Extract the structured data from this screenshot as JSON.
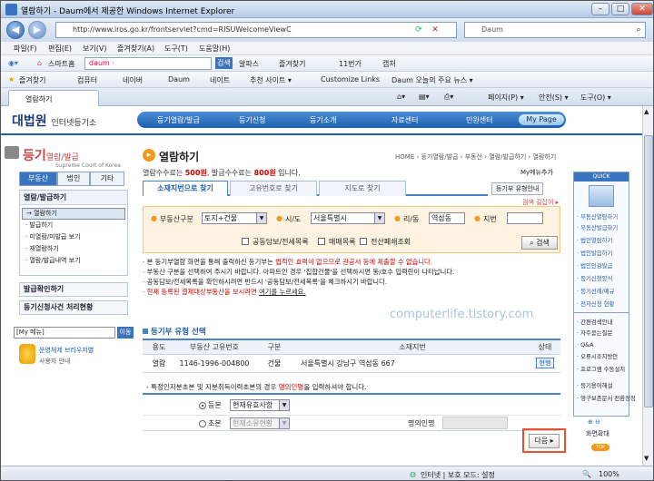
{
  "window": {
    "title": "열람하기 - Daum에서 제공한 Windows Internet Explorer",
    "address": "http://www.iros.go.kr/frontservlet?cmd=RISUWelcomeViewC",
    "search_placeholder": "Daum"
  },
  "menubar": [
    "파일(F)",
    "편집(E)",
    "보기(V)",
    "즐겨찾기(A)",
    "도구(T)",
    "도움말(H)"
  ],
  "toolbar1": {
    "smart_home": "스마트홈",
    "daum_search": "daum ·",
    "search_btn": "검색",
    "items": [
      "알파스",
      "즐겨찾기",
      "11번가",
      "캡처"
    ]
  },
  "toolbar2": {
    "favorites": "즐겨찾기",
    "items": [
      "컴퓨터",
      "네이버",
      "Daum",
      "네이트",
      "추천 사이트 ▾",
      "Customize Links",
      "Daum 오늘의 주요 뉴스 ▾"
    ]
  },
  "tabrow": {
    "tab_label": "열람하기",
    "right_items": [
      "페이지(P) ▾",
      "안전(S) ▾",
      "도구(O) ▾"
    ]
  },
  "site": {
    "logo_main": "대법원",
    "logo_sub": "인터넷등기소",
    "topnav": [
      "등기열람/발급",
      "등기신청",
      "등기소개",
      "자료센터",
      "민원센터"
    ],
    "mypage": "My Page",
    "left": {
      "title_main": "등기",
      "title_sub": "열람/발급",
      "subtitle": "Supreme Court of Korea",
      "tabs": [
        "부동산",
        "법인",
        "기타"
      ],
      "menu_header": "열람/발급하기",
      "menu_items": [
        "→ 열람하기",
        "· 발급하기",
        "· 미열람/미발급 보기",
        "· 재열람하기",
        "· 열람/발급내역 보기"
      ],
      "link1": "발급확인하기",
      "link2": "등기신청사건 처리현황",
      "mymenu_label": "[My 메뉴]",
      "mymenu_btn": "이동",
      "support_title": "운영체제 브라우저별",
      "support_sub": "사용자 안내"
    },
    "main": {
      "page_title": "열람하기",
      "breadcrumb": "HOME › 등기열람/발급 › 부동산 › 열람/발급하기 › 열람하기",
      "my_menu_add": "My메뉴추가",
      "guide": "등기부 유형안내",
      "fee_prefix": "열람수수료는 ",
      "fee1": "500원",
      "fee_mid": ", 발급수수료는 ",
      "fee2": "800원",
      "fee_suffix": " 입니다.",
      "subtabs": [
        "소재지번으로 찾기",
        "고유번호로 찾기",
        "지도로 찾기"
      ],
      "search_help": "검색 길잡이 ▸",
      "form": {
        "realty_type_label": "부동산구분",
        "realty_type_value": "토지+건물",
        "sido_label": "시/도",
        "sido_value": "서울특별시",
        "ridong_label": "리/동",
        "ridong_value": "역삼동",
        "jibun_label": "지번",
        "jibun_value": "",
        "chk1": "공동담보/전세목록",
        "chk2": "매매목록",
        "chk3": "전산폐쇄조회",
        "search_btn": "검색"
      },
      "notes": [
        {
          "text1": "본 등기부열람 화면을 통해 출력하신 등기부는 ",
          "red": "법적인 효력이 없으므로 관공서 등에 제출할 수 없습니다.",
          "text2": ""
        },
        {
          "text1": "부동산 구분을 선택하여 주시기 바랍니다. 아파트인 경우 '집합건물'을 선택하시면 동/호수 입력란이 나타납니다.",
          "red": "",
          "text2": ""
        },
        {
          "text1": "공동담보/전세목록을 확인하시려면 반드시 '공동담보/전세목록'을 체크하시기 바랍니다.",
          "red": "",
          "text2": ""
        },
        {
          "text1": "",
          "red": "현재 등록된 결제대상부동산을 보시려면 ",
          "text2": "여기를 누르세요."
        }
      ],
      "watermark": "computerlife.tistory.com",
      "section_title": "등기부 유형 선택",
      "table": {
        "headers": [
          "용도",
          "부동산 고유번호",
          "구분",
          "소재지번",
          "상태"
        ],
        "rows": [
          [
            "열람",
            "1146-1996-004800",
            "건물",
            "서울특별시 강남구 역삼동 667",
            "현행"
          ]
        ]
      },
      "owner_note_pre": "- 특정인지분초본 및 지분취득이력초본의 경우 ",
      "owner_note_red": "명의인명",
      "owner_note_post": "을 입력하셔야 합니다.",
      "owner": {
        "opt1": "등본",
        "opt1_select": "현재유효사항",
        "opt2": "초본",
        "opt2_select": "현재소유현황",
        "name_label": "명의인명"
      },
      "next_btn": "다음 ▸"
    },
    "quick": {
      "header": "QUICK",
      "items_blue": [
        "· 부동산열람하기",
        "· 부동산발급하기",
        "· 법인열람하기",
        "· 법인발급하기",
        "· 법인인감발급",
        "· 등기신청양식",
        "· 등기선례/예규",
        "· 전자신청 현황"
      ],
      "items": [
        "· 간편검색안내",
        "· 자주묻는질문",
        "· Q&A",
        "· 오류시조치방안",
        "· 프로그램 수동설치",
        "· 등기용어해설",
        "· 영구보존문서 전환정정"
      ],
      "bottom": "화면확대",
      "top": "TOP"
    }
  },
  "statusbar": {
    "zone": "인터넷 | 보호 모드: 설정",
    "zoom": "100%"
  }
}
